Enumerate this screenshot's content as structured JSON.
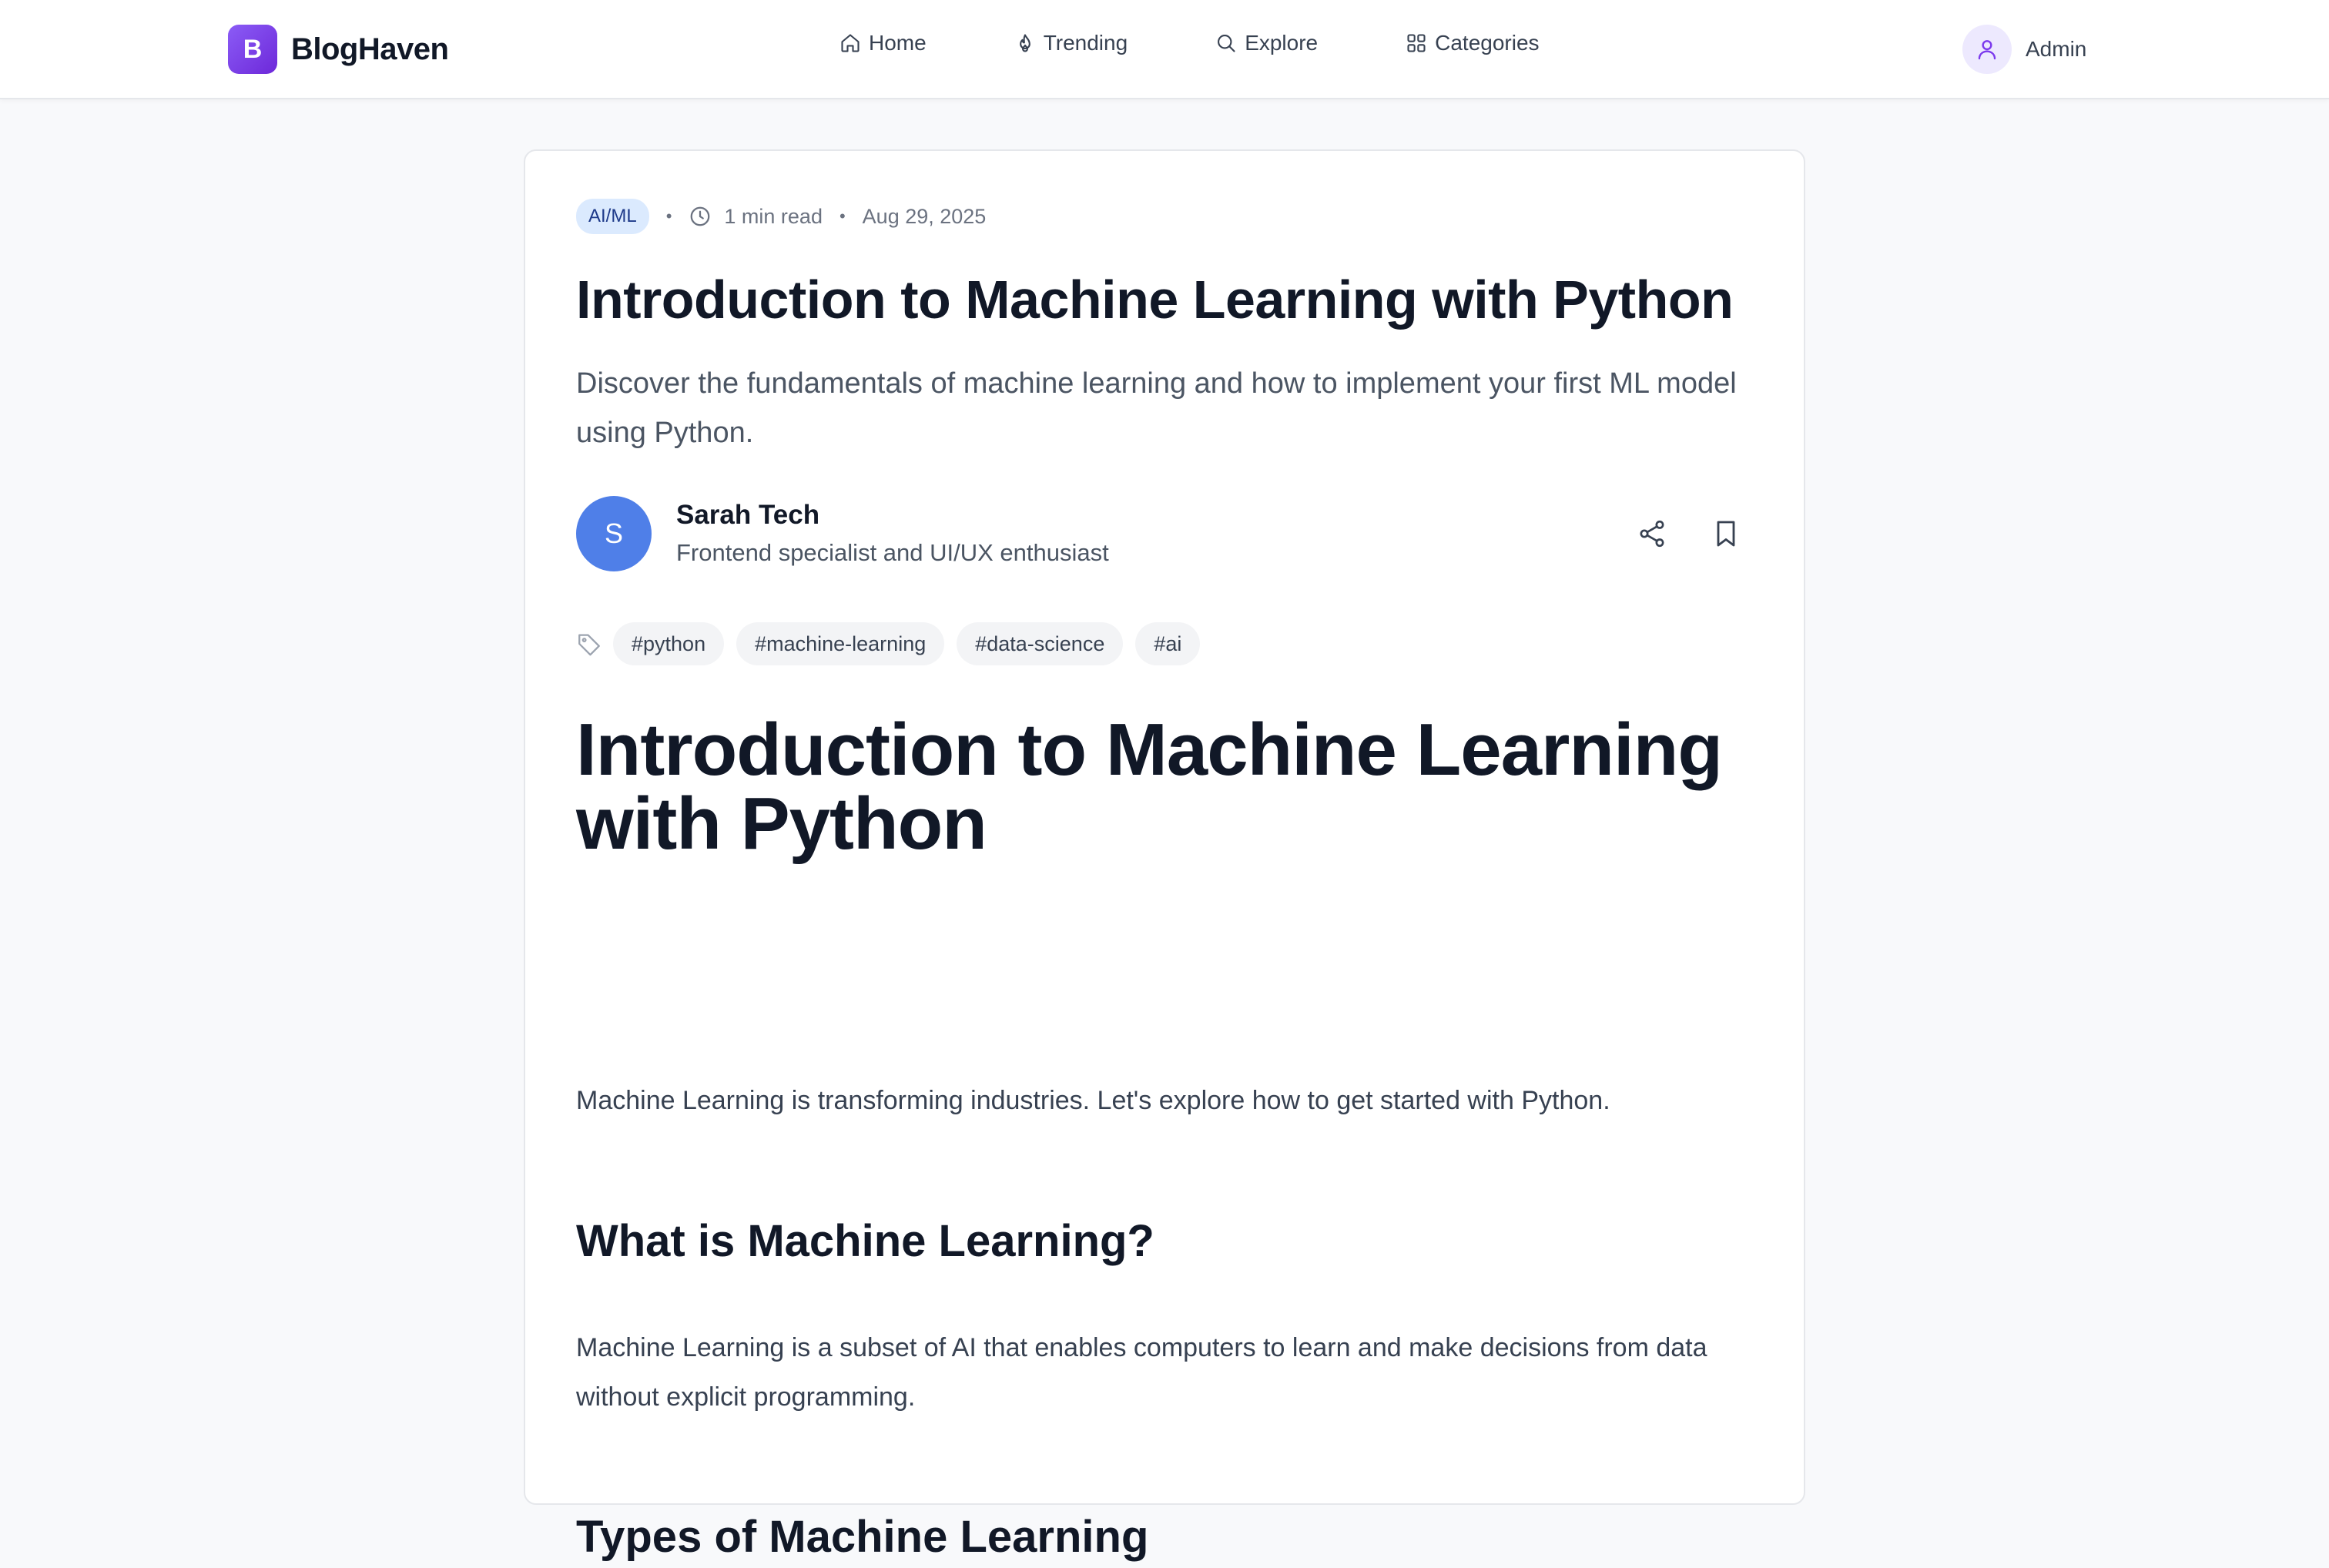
{
  "header": {
    "logo_letter": "B",
    "brand": "BlogHaven",
    "nav": [
      {
        "label": "Home",
        "icon": "home-icon"
      },
      {
        "label": "Trending",
        "icon": "flame-icon"
      },
      {
        "label": "Explore",
        "icon": "search-icon"
      },
      {
        "label": "Categories",
        "icon": "grid-icon"
      }
    ],
    "user": {
      "name": "Admin",
      "icon": "user-icon"
    }
  },
  "article": {
    "category": "AI/ML",
    "read_time": "1 min read",
    "date": "Aug 29, 2025",
    "title": "Introduction to Machine Learning with Python",
    "subtitle": "Discover the fundamentals of machine learning and how to implement your first ML model using Python.",
    "author": {
      "initial": "S",
      "name": "Sarah Tech",
      "bio": "Frontend specialist and UI/UX enthusiast"
    },
    "actions": [
      "share-icon",
      "bookmark-icon"
    ],
    "tags": [
      "#python",
      "#machine-learning",
      "#data-science",
      "#ai"
    ],
    "body": {
      "heading": "Introduction to Machine Learning with Python",
      "intro": "Machine Learning is transforming industries. Let's explore how to get started with Python.",
      "section1_heading": "What is Machine Learning?",
      "section1_text": "Machine Learning is a subset of AI that enables computers to learn and make decisions from data without explicit programming.",
      "section2_heading": "Types of Machine Learning"
    }
  },
  "colors": {
    "brand": "#7c3aed",
    "badge_bg": "#dbeafe",
    "badge_text": "#1e3a8a",
    "author_avatar": "#4f7fe8",
    "page_bg": "#f8f9fb"
  }
}
